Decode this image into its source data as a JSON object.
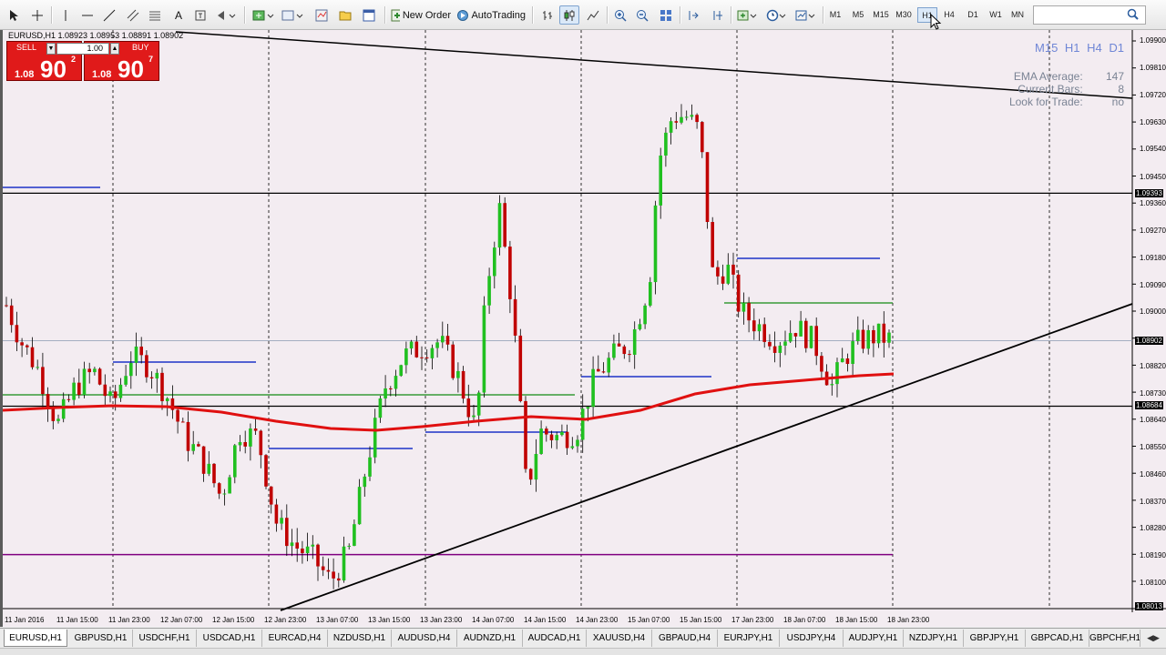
{
  "toolbar": {
    "new_order_label": "New Order",
    "autotrading_label": "AutoTrading",
    "timeframes": [
      "M1",
      "M5",
      "M15",
      "M30",
      "H1",
      "H4",
      "D1",
      "W1",
      "MN"
    ],
    "active_timeframe": "H1"
  },
  "chart": {
    "title": "EURUSD,H1  1.08923 1.08953 1.08891 1.08902",
    "symbol": "EURUSD",
    "timeframe": "H1",
    "open": 1.08923,
    "high": 1.08953,
    "low": 1.08891,
    "close": 1.08902
  },
  "one_click": {
    "sell_label": "SELL",
    "buy_label": "BUY",
    "lot_value": "1.00",
    "sell_small": "1.08",
    "sell_big": "90",
    "sell_sup": "2",
    "buy_small": "1.08",
    "buy_big": "90",
    "buy_sup": "7"
  },
  "indicator_panel": {
    "timeframes_label": "M15 H1 H4 D1",
    "rows": [
      {
        "label": "EMA Average:",
        "value": "147"
      },
      {
        "label": "Current Bars:",
        "value": "8"
      },
      {
        "label": "Look for Trade:",
        "value": "no"
      }
    ]
  },
  "price_axis": {
    "labels": [
      "1.09810",
      "1.09720",
      "1.09630",
      "1.09540",
      "1.09450",
      "1.09360",
      "1.09270",
      "1.09180",
      "1.09090",
      "1.09000",
      "1.08820",
      "1.08730",
      "1.08640",
      "1.08550",
      "1.08460",
      "1.08370",
      "1.08280",
      "1.08190",
      "1.08100"
    ],
    "markers": {
      "top": "1.09900",
      "resistance": "1.09393",
      "current": "1.08902",
      "support": "1.08684",
      "bottom": "1.08013"
    }
  },
  "time_axis": {
    "labels": [
      "11 Jan 2016",
      "11 Jan 15:00",
      "11 Jan 23:00",
      "12 Jan 07:00",
      "12 Jan 15:00",
      "12 Jan 23:00",
      "13 Jan 07:00",
      "13 Jan 15:00",
      "13 Jan 23:00",
      "14 Jan 07:00",
      "14 Jan 15:00",
      "14 Jan 23:00",
      "15 Jan 07:00",
      "15 Jan 15:00",
      "17 Jan 23:00",
      "18 Jan 07:00",
      "18 Jan 15:00",
      "18 Jan 23:00"
    ]
  },
  "chart_data": {
    "type": "candlestick",
    "price_range": [
      1.08013,
      1.099
    ],
    "ema": "red",
    "horizontal_levels": [
      1.09393,
      1.08684,
      1.0819
    ],
    "bull_color": "#20c020",
    "bear_color": "#c00000"
  },
  "tabs": [
    {
      "label": "EURUSD,H1",
      "active": true
    },
    {
      "label": "GBPUSD,H1"
    },
    {
      "label": "USDCHF,H1"
    },
    {
      "label": "USDCAD,H1"
    },
    {
      "label": "EURCAD,H4"
    },
    {
      "label": "NZDUSD,H1"
    },
    {
      "label": "AUDUSD,H4"
    },
    {
      "label": "AUDNZD,H1"
    },
    {
      "label": "AUDCAD,H1"
    },
    {
      "label": "XAUUSD,H4"
    },
    {
      "label": "GBPAUD,H4"
    },
    {
      "label": "EURJPY,H1"
    },
    {
      "label": "USDJPY,H4"
    },
    {
      "label": "AUDJPY,H1"
    },
    {
      "label": "NZDJPY,H1"
    },
    {
      "label": "GBPJPY,H1"
    },
    {
      "label": "GBPCAD,H1"
    },
    {
      "label": "GBPCHF,H1"
    }
  ]
}
